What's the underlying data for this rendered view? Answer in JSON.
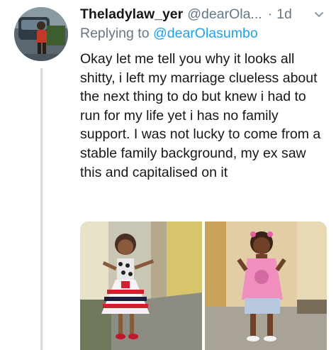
{
  "tweet": {
    "display_name": "Theladylaw_yer",
    "handle": "@dearOla...",
    "separator": "·",
    "time": "1d",
    "replying_prefix": "Replying to",
    "replying_to": "@dearOlasumbo",
    "text": "Okay let me tell you why it looks all shitty, i left my marriage clueless about the next thing to do but knew i had to run for my life yet i has no family support. I was not lucky to come from a stable family background, my ex saw this and capitalised on it"
  },
  "icons": {
    "more": "chevron-down-icon"
  },
  "colors": {
    "link": "#1da1f2",
    "secondary_text": "#657786",
    "thread_line": "#cfd9de"
  }
}
